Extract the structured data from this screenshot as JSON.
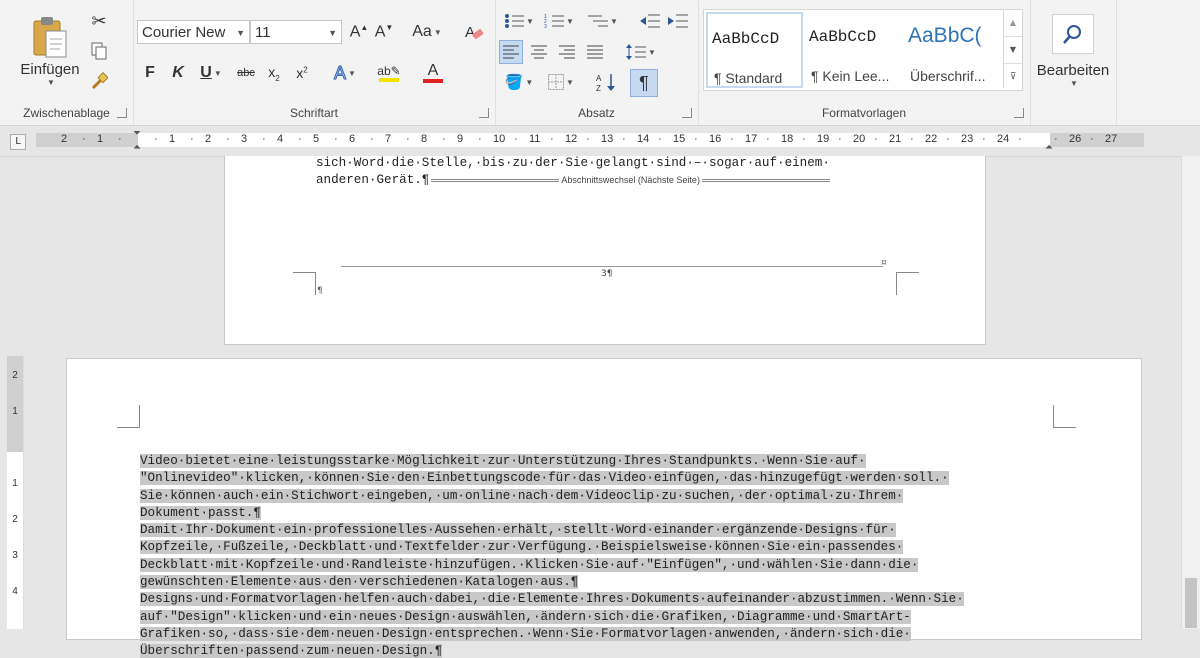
{
  "ribbon": {
    "clipboard": {
      "label": "Zwischenablage",
      "paste_label": "Einfügen"
    },
    "font": {
      "label": "Schriftart",
      "font_name": "Courier New",
      "font_size": "11",
      "case_label": "Aa"
    },
    "paragraph": {
      "label": "Absatz"
    },
    "styles": {
      "label": "Formatvorlagen",
      "items": [
        {
          "sample": "AaBbCcD",
          "name": "¶ Standard"
        },
        {
          "sample": "AaBbCcD",
          "name": "¶ Kein Lee..."
        },
        {
          "sample": "AaBbC(",
          "name": "Überschrif..."
        }
      ]
    },
    "editing": {
      "label": "Bearbeiten"
    }
  },
  "ruler": {
    "tab_selector": "L",
    "ticks": [
      "2",
      "1",
      "",
      "1",
      "2",
      "3",
      "4",
      "5",
      "6",
      "7",
      "8",
      "9",
      "10",
      "11",
      "12",
      "13",
      "14",
      "15",
      "16",
      "17",
      "18",
      "19",
      "20",
      "21",
      "22",
      "23",
      "24",
      "",
      "26",
      "27"
    ],
    "vticks": [
      "2",
      "1",
      "",
      "1",
      "2",
      "3",
      "4"
    ]
  },
  "page1": {
    "line1": "sich·Word·die·Stelle,·bis·zu·der·Sie·gelangt·sind·–·sogar·auf·einem·",
    "line2": "anderen·Gerät.¶",
    "section_break": "Abschnittswechsel (Nächste Seite)",
    "footer_page": "3¶",
    "footer_mark_left": "¶",
    "footer_mark_right": "¤"
  },
  "page2": {
    "lines": [
      "Video·bietet·eine·leistungsstarke·Möglichkeit·zur·Unterstützung·Ihres·Standpunkts.·Wenn·Sie·auf·",
      "\"Onlinevideo\"·klicken,·können·Sie·den·Einbettungscode·für·das·Video·einfügen,·das·hinzugefügt·werden·soll.·",
      "Sie·können·auch·ein·Stichwort·eingeben,·um·online·nach·dem·Videoclip·zu·suchen,·der·optimal·zu·Ihrem·",
      "Dokument·passt.¶",
      "Damit·Ihr·Dokument·ein·professionelles·Aussehen·erhält,·stellt·Word·einander·ergänzende·Designs·für·",
      "Kopfzeile,·Fußzeile,·Deckblatt·und·Textfelder·zur·Verfügung.·Beispielsweise·können·Sie·ein·passendes·",
      "Deckblatt·mit·Kopfzeile·und·Randleiste·hinzufügen.·Klicken·Sie·auf·\"Einfügen\",·und·wählen·Sie·dann·die·",
      "gewünschten·Elemente·aus·den·verschiedenen·Katalogen·aus.¶",
      "Designs·und·Formatvorlagen·helfen·auch·dabei,·die·Elemente·Ihres·Dokuments·aufeinander·abzustimmen.·Wenn·Sie·",
      "auf·\"Design\"·klicken·und·ein·neues·Design·auswählen,·ändern·sich·die·Grafiken,·Diagramme·und·SmartArt-",
      "Grafiken·so,·dass·sie·dem·neuen·Design·entsprechen.·Wenn·Sie·Formatvorlagen·anwenden,·ändern·sich·die·",
      "Überschriften·passend·zum·neuen·Design.¶"
    ]
  },
  "colors": {
    "highlight": "#c8c8c8",
    "font_color_bar": "#e02020",
    "highlight_bar": "#f2e400",
    "active_button": "#c5d9f1"
  }
}
